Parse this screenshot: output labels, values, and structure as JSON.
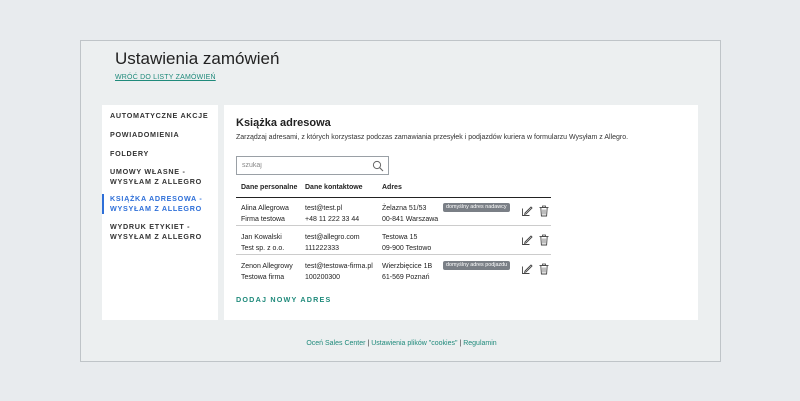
{
  "page": {
    "title": "Ustawienia zamówień",
    "back_link": "WRÓĆ DO LISTY ZAMÓWIEŃ"
  },
  "sidebar": {
    "items": [
      {
        "label": "AUTOMATYCZNE AKCJE",
        "active": false
      },
      {
        "label": "POWIADOMIENIA",
        "active": false
      },
      {
        "label": "FOLDERY",
        "active": false
      },
      {
        "label_line1": "UMOWY WŁASNE -",
        "label_line2": "WYSYŁAM Z ALLEGRO",
        "active": false
      },
      {
        "label_line1": "KSIĄŻKA ADRESOWA -",
        "label_line2": "WYSYŁAM Z ALLEGRO",
        "active": true
      },
      {
        "label_line1": "WYDRUK ETYKIET -",
        "label_line2": "WYSYŁAM Z ALLEGRO",
        "active": false
      }
    ]
  },
  "main": {
    "title": "Książka adresowa",
    "description": "Zarządzaj adresami, z których korzystasz podczas zamawiania przesyłek i podjazdów kuriera w formularzu Wysyłam z Allegro.",
    "search": {
      "placeholder": "szukaj",
      "value": "",
      "icon": "search-icon"
    },
    "table": {
      "headers": [
        "Dane personalne",
        "Dane kontaktowe",
        "Adres"
      ],
      "rows": [
        {
          "name": "Alina Allegrowa",
          "company": "Firma testowa",
          "email": "test@test.pl",
          "phone": "+48 11 222 33 44",
          "street": "Żelazna 51/53",
          "city": "00-841 Warszawa",
          "badge": "domyślny adres nadawcy"
        },
        {
          "name": "Jan Kowalski",
          "company": "Test sp. z o.o.",
          "email": "test@allegro.com",
          "phone": "111222333",
          "street": "Testowa 15",
          "city": "09-900 Testowo",
          "badge": ""
        },
        {
          "name": "Zenon Allegrowy",
          "company": "Testowa firma",
          "email": "test@testowa-firma.pl",
          "phone": "100200300",
          "street": "Wierzbięcice 1B",
          "city": "61-569 Poznań",
          "badge": "domyślny adres podjazdu"
        }
      ],
      "row_icons": [
        "edit-icon",
        "trash-icon"
      ]
    },
    "add_link": "DODAJ NOWY ADRES"
  },
  "footer": {
    "link1": "Oceń Sales Center",
    "sep1": " | ",
    "link2": "Ustawienia plików \"cookies\"",
    "sep2": " | ",
    "link3": "Regulamin"
  },
  "colors": {
    "accent_green": "#1f8a7b",
    "active_blue": "#2e6fd8",
    "badge_gray": "#7a7f86",
    "background": "#e8ebee"
  }
}
